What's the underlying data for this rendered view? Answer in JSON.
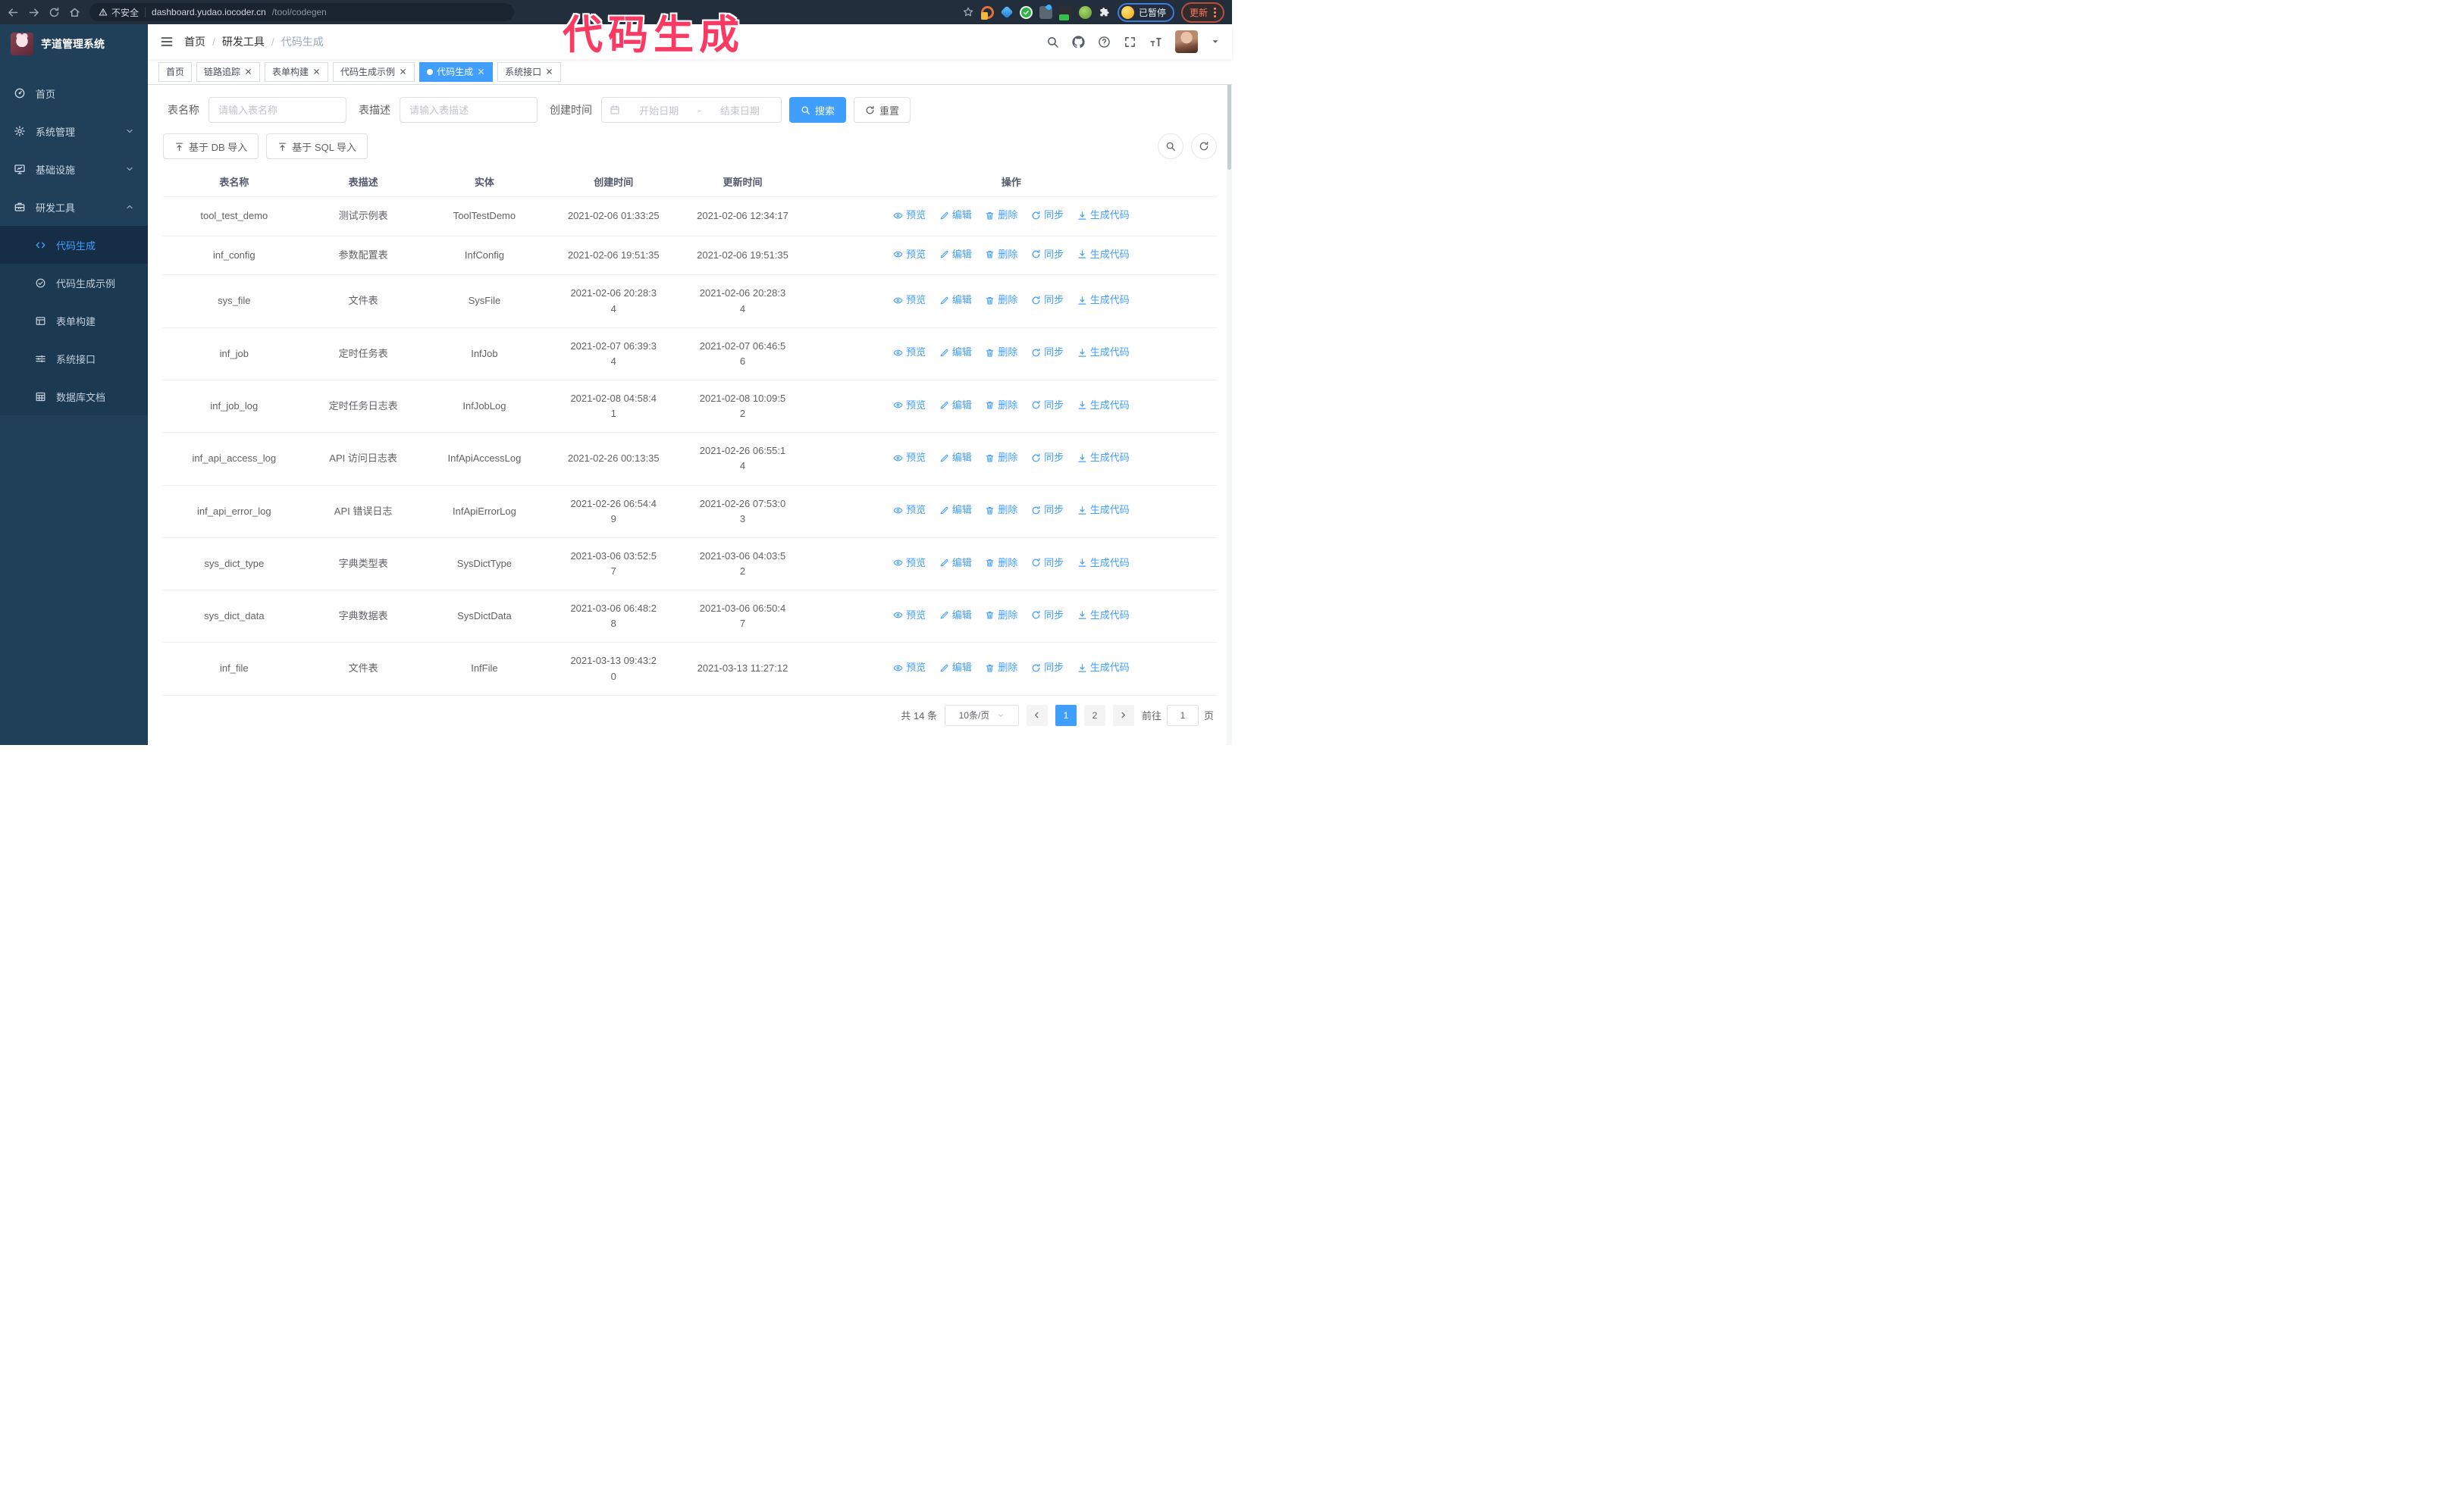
{
  "browser": {
    "security_warning": "不安全",
    "url_host": "dashboard.yudao.iocoder.cn",
    "url_path": "/tool/codegen",
    "paused_badge": "已暂停",
    "update_button": "更新"
  },
  "annotation": {
    "text": "代码生成",
    "color": "#fa3a63"
  },
  "sidebar": {
    "app_title": "芋道管理系统",
    "items": [
      {
        "label": "首页"
      },
      {
        "label": "系统管理"
      },
      {
        "label": "基础设施"
      },
      {
        "label": "研发工具"
      }
    ],
    "submenu": [
      {
        "label": "代码生成",
        "active": true
      },
      {
        "label": "代码生成示例"
      },
      {
        "label": "表单构建"
      },
      {
        "label": "系统接口"
      },
      {
        "label": "数据库文档"
      }
    ]
  },
  "header": {
    "breadcrumb": [
      "首页",
      "研发工具",
      "代码生成"
    ]
  },
  "tabs": [
    {
      "label": "首页"
    },
    {
      "label": "链路追踪",
      "closable": true
    },
    {
      "label": "表单构建",
      "closable": true
    },
    {
      "label": "代码生成示例",
      "closable": true
    },
    {
      "label": "代码生成",
      "closable": true,
      "active": true
    },
    {
      "label": "系统接口",
      "closable": true
    }
  ],
  "filters": {
    "table_name_label": "表名称",
    "table_name_placeholder": "请输入表名称",
    "table_desc_label": "表描述",
    "table_desc_placeholder": "请输入表描述",
    "create_time_label": "创建时间",
    "date_start_placeholder": "开始日期",
    "date_separator": "-",
    "date_end_placeholder": "结束日期",
    "search_button": "搜索",
    "reset_button": "重置"
  },
  "toolbar": {
    "import_db_button": "基于 DB 导入",
    "import_sql_button": "基于 SQL 导入"
  },
  "table": {
    "columns": [
      "表名称",
      "表描述",
      "实体",
      "创建时间",
      "更新时间",
      "操作"
    ],
    "actions": [
      "预览",
      "编辑",
      "删除",
      "同步",
      "生成代码"
    ],
    "rows": [
      {
        "name": "tool_test_demo",
        "desc": "测试示例表",
        "entity": "ToolTestDemo",
        "created": "2021-02-06 01:33:25",
        "updated": "2021-02-06 12:34:17"
      },
      {
        "name": "inf_config",
        "desc": "参数配置表",
        "entity": "InfConfig",
        "created": "2021-02-06 19:51:35",
        "updated": "2021-02-06 19:51:35"
      },
      {
        "name": "sys_file",
        "desc": "文件表",
        "entity": "SysFile",
        "created": "2021-02-06 20:28:3\n4",
        "updated": "2021-02-06 20:28:3\n4"
      },
      {
        "name": "inf_job",
        "desc": "定时任务表",
        "entity": "InfJob",
        "created": "2021-02-07 06:39:3\n4",
        "updated": "2021-02-07 06:46:5\n6"
      },
      {
        "name": "inf_job_log",
        "desc": "定时任务日志表",
        "entity": "InfJobLog",
        "created": "2021-02-08 04:58:4\n1",
        "updated": "2021-02-08 10:09:5\n2"
      },
      {
        "name": "inf_api_access_log",
        "desc": "API 访问日志表",
        "entity": "InfApiAccessLog",
        "created": "2021-02-26 00:13:35",
        "updated": "2021-02-26 06:55:1\n4"
      },
      {
        "name": "inf_api_error_log",
        "desc": "API 错误日志",
        "entity": "InfApiErrorLog",
        "created": "2021-02-26 06:54:4\n9",
        "updated": "2021-02-26 07:53:0\n3"
      },
      {
        "name": "sys_dict_type",
        "desc": "字典类型表",
        "entity": "SysDictType",
        "created": "2021-03-06 03:52:5\n7",
        "updated": "2021-03-06 04:03:5\n2"
      },
      {
        "name": "sys_dict_data",
        "desc": "字典数据表",
        "entity": "SysDictData",
        "created": "2021-03-06 06:48:2\n8",
        "updated": "2021-03-06 06:50:4\n7"
      },
      {
        "name": "inf_file",
        "desc": "文件表",
        "entity": "InfFile",
        "created": "2021-03-13 09:43:2\n0",
        "updated": "2021-03-13 11:27:12"
      }
    ]
  },
  "pagination": {
    "total": "共 14 条",
    "page_size": "10条/页",
    "pages_list": [
      {
        "label": "1",
        "active": true
      },
      {
        "label": "2"
      }
    ],
    "goto_label": "前往",
    "goto_value": "1",
    "page_suffix": "页"
  }
}
